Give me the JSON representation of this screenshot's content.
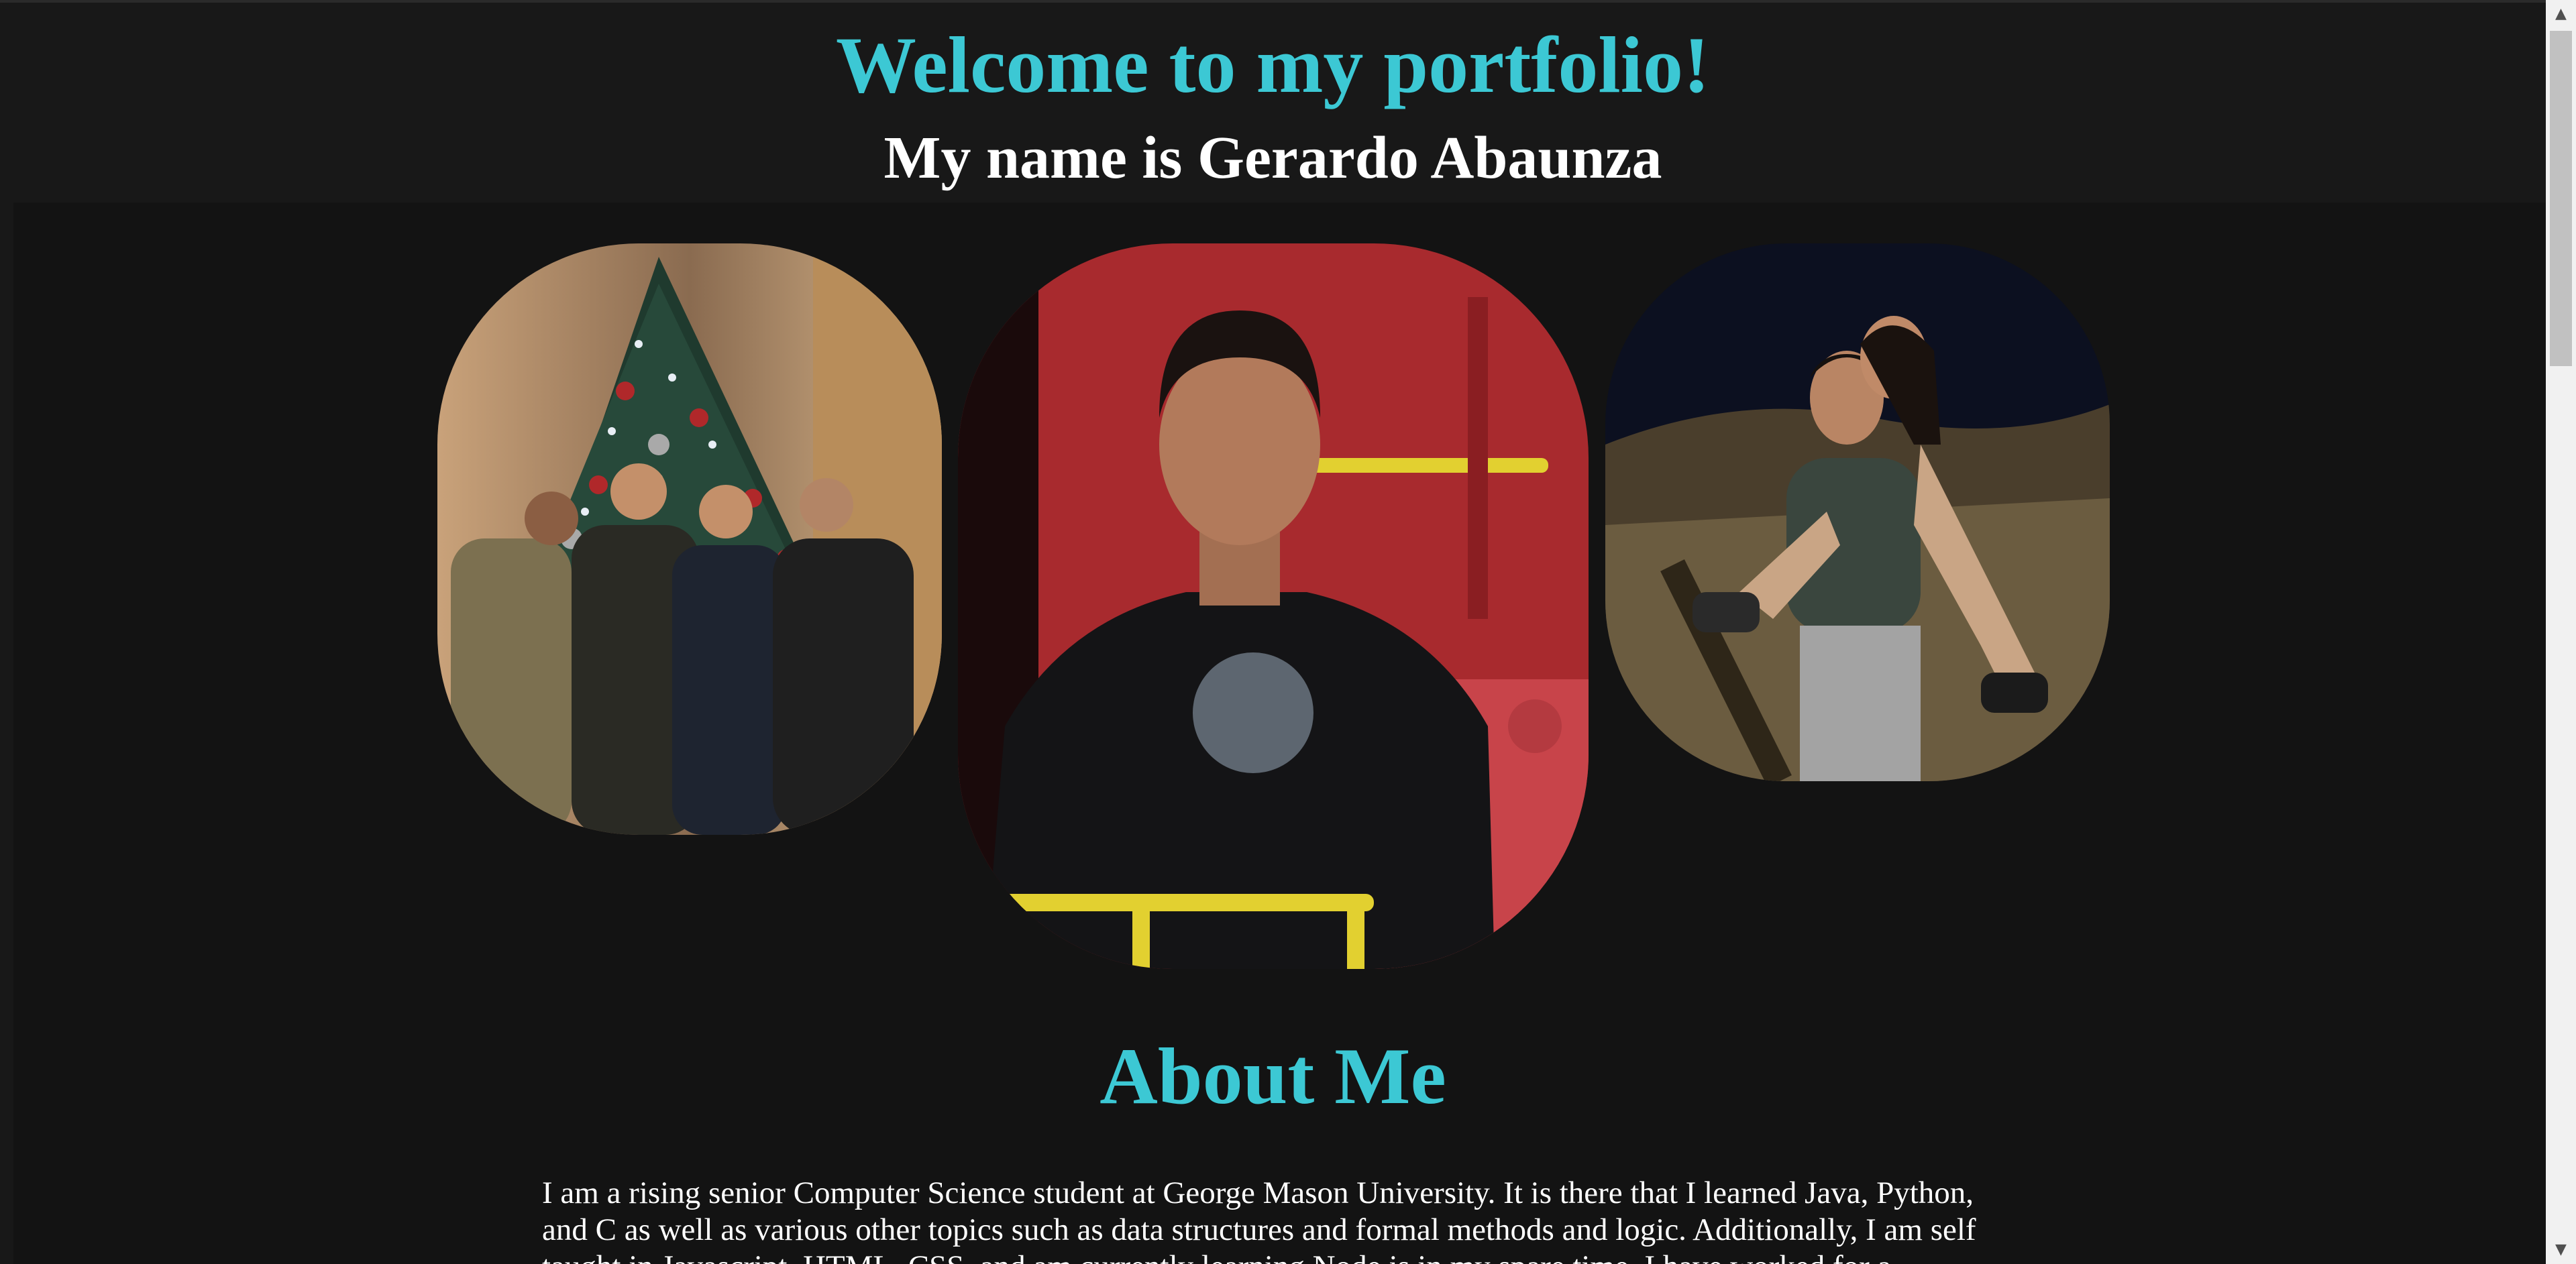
{
  "header": {
    "welcome": "Welcome to my portfolio!",
    "name": "My name is Gerardo Abaunza"
  },
  "photos": [
    {
      "icon": "group-christmas-tree-photo"
    },
    {
      "icon": "portrait-red-train-photo"
    },
    {
      "icon": "couple-piggyback-photo"
    }
  ],
  "about": {
    "title": "About Me",
    "text": "I am a rising senior Computer Science student at George Mason University. It is there that I learned Java, Python, and C as well as various other topics such as data structures and formal methods and logic. Additionally, I am self taught in Javascript, HTML, CSS, and am currently learning Node.js in my spare time. I have worked for a company"
  },
  "colors": {
    "accent": "#3cc8d4",
    "background": "#131313",
    "header_background": "#181818",
    "text": "#ffffff"
  }
}
